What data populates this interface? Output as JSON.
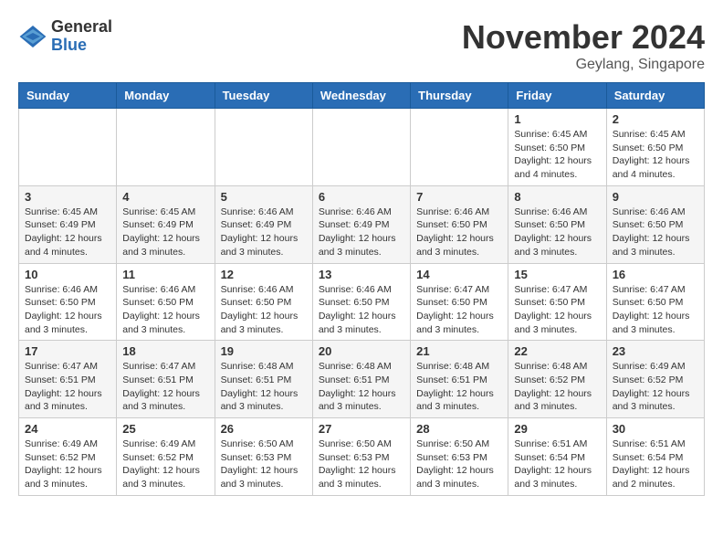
{
  "header": {
    "logo_general": "General",
    "logo_blue": "Blue",
    "month_title": "November 2024",
    "location": "Geylang, Singapore"
  },
  "weekdays": [
    "Sunday",
    "Monday",
    "Tuesday",
    "Wednesday",
    "Thursday",
    "Friday",
    "Saturday"
  ],
  "weeks": [
    [
      {
        "day": "",
        "info": ""
      },
      {
        "day": "",
        "info": ""
      },
      {
        "day": "",
        "info": ""
      },
      {
        "day": "",
        "info": ""
      },
      {
        "day": "",
        "info": ""
      },
      {
        "day": "1",
        "info": "Sunrise: 6:45 AM\nSunset: 6:50 PM\nDaylight: 12 hours and 4 minutes."
      },
      {
        "day": "2",
        "info": "Sunrise: 6:45 AM\nSunset: 6:50 PM\nDaylight: 12 hours and 4 minutes."
      }
    ],
    [
      {
        "day": "3",
        "info": "Sunrise: 6:45 AM\nSunset: 6:49 PM\nDaylight: 12 hours and 4 minutes."
      },
      {
        "day": "4",
        "info": "Sunrise: 6:45 AM\nSunset: 6:49 PM\nDaylight: 12 hours and 3 minutes."
      },
      {
        "day": "5",
        "info": "Sunrise: 6:46 AM\nSunset: 6:49 PM\nDaylight: 12 hours and 3 minutes."
      },
      {
        "day": "6",
        "info": "Sunrise: 6:46 AM\nSunset: 6:49 PM\nDaylight: 12 hours and 3 minutes."
      },
      {
        "day": "7",
        "info": "Sunrise: 6:46 AM\nSunset: 6:50 PM\nDaylight: 12 hours and 3 minutes."
      },
      {
        "day": "8",
        "info": "Sunrise: 6:46 AM\nSunset: 6:50 PM\nDaylight: 12 hours and 3 minutes."
      },
      {
        "day": "9",
        "info": "Sunrise: 6:46 AM\nSunset: 6:50 PM\nDaylight: 12 hours and 3 minutes."
      }
    ],
    [
      {
        "day": "10",
        "info": "Sunrise: 6:46 AM\nSunset: 6:50 PM\nDaylight: 12 hours and 3 minutes."
      },
      {
        "day": "11",
        "info": "Sunrise: 6:46 AM\nSunset: 6:50 PM\nDaylight: 12 hours and 3 minutes."
      },
      {
        "day": "12",
        "info": "Sunrise: 6:46 AM\nSunset: 6:50 PM\nDaylight: 12 hours and 3 minutes."
      },
      {
        "day": "13",
        "info": "Sunrise: 6:46 AM\nSunset: 6:50 PM\nDaylight: 12 hours and 3 minutes."
      },
      {
        "day": "14",
        "info": "Sunrise: 6:47 AM\nSunset: 6:50 PM\nDaylight: 12 hours and 3 minutes."
      },
      {
        "day": "15",
        "info": "Sunrise: 6:47 AM\nSunset: 6:50 PM\nDaylight: 12 hours and 3 minutes."
      },
      {
        "day": "16",
        "info": "Sunrise: 6:47 AM\nSunset: 6:50 PM\nDaylight: 12 hours and 3 minutes."
      }
    ],
    [
      {
        "day": "17",
        "info": "Sunrise: 6:47 AM\nSunset: 6:51 PM\nDaylight: 12 hours and 3 minutes."
      },
      {
        "day": "18",
        "info": "Sunrise: 6:47 AM\nSunset: 6:51 PM\nDaylight: 12 hours and 3 minutes."
      },
      {
        "day": "19",
        "info": "Sunrise: 6:48 AM\nSunset: 6:51 PM\nDaylight: 12 hours and 3 minutes."
      },
      {
        "day": "20",
        "info": "Sunrise: 6:48 AM\nSunset: 6:51 PM\nDaylight: 12 hours and 3 minutes."
      },
      {
        "day": "21",
        "info": "Sunrise: 6:48 AM\nSunset: 6:51 PM\nDaylight: 12 hours and 3 minutes."
      },
      {
        "day": "22",
        "info": "Sunrise: 6:48 AM\nSunset: 6:52 PM\nDaylight: 12 hours and 3 minutes."
      },
      {
        "day": "23",
        "info": "Sunrise: 6:49 AM\nSunset: 6:52 PM\nDaylight: 12 hours and 3 minutes."
      }
    ],
    [
      {
        "day": "24",
        "info": "Sunrise: 6:49 AM\nSunset: 6:52 PM\nDaylight: 12 hours and 3 minutes."
      },
      {
        "day": "25",
        "info": "Sunrise: 6:49 AM\nSunset: 6:52 PM\nDaylight: 12 hours and 3 minutes."
      },
      {
        "day": "26",
        "info": "Sunrise: 6:50 AM\nSunset: 6:53 PM\nDaylight: 12 hours and 3 minutes."
      },
      {
        "day": "27",
        "info": "Sunrise: 6:50 AM\nSunset: 6:53 PM\nDaylight: 12 hours and 3 minutes."
      },
      {
        "day": "28",
        "info": "Sunrise: 6:50 AM\nSunset: 6:53 PM\nDaylight: 12 hours and 3 minutes."
      },
      {
        "day": "29",
        "info": "Sunrise: 6:51 AM\nSunset: 6:54 PM\nDaylight: 12 hours and 3 minutes."
      },
      {
        "day": "30",
        "info": "Sunrise: 6:51 AM\nSunset: 6:54 PM\nDaylight: 12 hours and 2 minutes."
      }
    ]
  ]
}
